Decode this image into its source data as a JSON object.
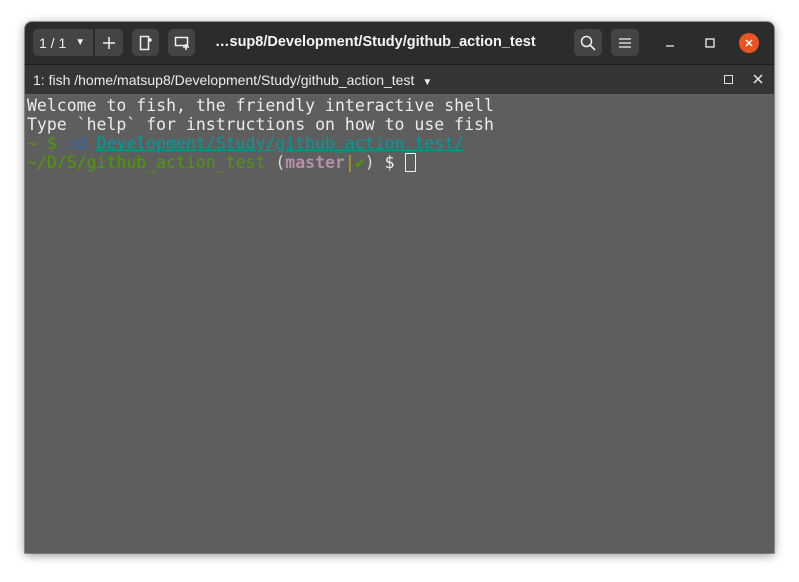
{
  "header": {
    "tab_counter": "1 / 1",
    "title": "…sup8/Development/Study/github_action_test",
    "icons": {
      "tab_dropdown": "chevron-down-icon",
      "new_tab": "plus-icon",
      "split": "split-terminal-icon",
      "new_window": "new-tab-icon",
      "search": "search-icon",
      "menu": "hamburger-menu-icon",
      "minimize": "minimize-icon",
      "maximize": "maximize-icon",
      "close": "close-icon"
    }
  },
  "tab": {
    "title": "1: fish /home/matsup8/Development/Study/github_action_test"
  },
  "terminal": {
    "line1": "Welcome to fish, the friendly interactive shell",
    "line2": "Type `help` for instructions on how to use fish",
    "line3": {
      "prompt": "~ $ ",
      "command": "cd",
      "argument": "Development/Study/github_action_test/"
    },
    "line4": {
      "cwd": "~/D/S/github_action_test",
      "open_paren": " (",
      "branch": "master",
      "separator": "|",
      "status": "✔",
      "close_paren": ")",
      "prompt_symbol": " $ "
    }
  },
  "colors": {
    "window_background": "#5e5e5e",
    "headerbar": "#2c2c2c",
    "close_button": "#e95420",
    "prompt_green": "#4e9a06",
    "command_blue": "#3465a4",
    "path_cyan": "#06989a",
    "branch_purple": "#b48ead"
  }
}
